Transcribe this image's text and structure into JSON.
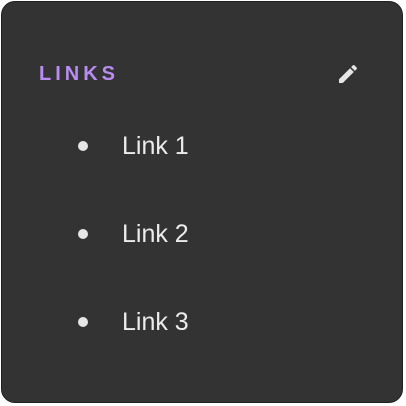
{
  "widget": {
    "title": "LINKS",
    "edit_icon": "pencil-icon",
    "colors": {
      "background": "#333333",
      "title": "#b98cf2",
      "text": "#ececec"
    }
  },
  "links": [
    {
      "label": "Link 1"
    },
    {
      "label": "Link 2"
    },
    {
      "label": "Link 3"
    }
  ]
}
